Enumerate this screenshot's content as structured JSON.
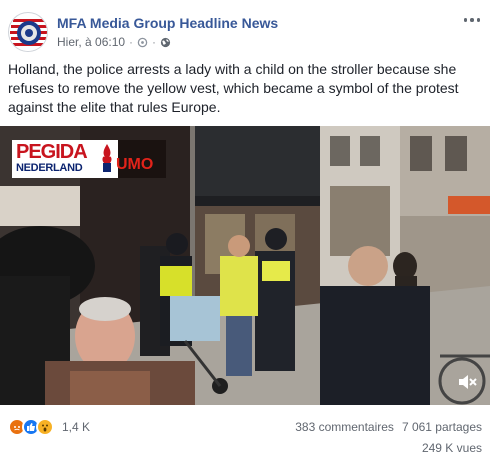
{
  "post": {
    "page_name": "MFA Media Group Headline News",
    "time": "Hier, à 06:10",
    "separator": "·",
    "text": "Holland, the police arrests a lady with a child on the stroller because she refuses to remove the yellow vest, which became a symbol of the protest against the elite that rules Europe.",
    "icons": {
      "more": "more-options-icon",
      "privacy": "globe-icon",
      "settings": "settings-icon"
    }
  },
  "video": {
    "watermark_top": "PEGIDA",
    "watermark_bottom": "NEDERLAND",
    "shop_sign": "UMO",
    "mute_icon": "speaker-muted-icon"
  },
  "footer": {
    "reaction_count": "1,4 K",
    "reactions": [
      "angry",
      "like",
      "wow"
    ],
    "comments": "383 commentaires",
    "shares": "7 061 partages",
    "views": "249 K vues"
  },
  "colors": {
    "link": "#385898",
    "meta": "#616770",
    "angry": "#e9710f",
    "like": "#1877f2",
    "wow": "#f7b125"
  }
}
